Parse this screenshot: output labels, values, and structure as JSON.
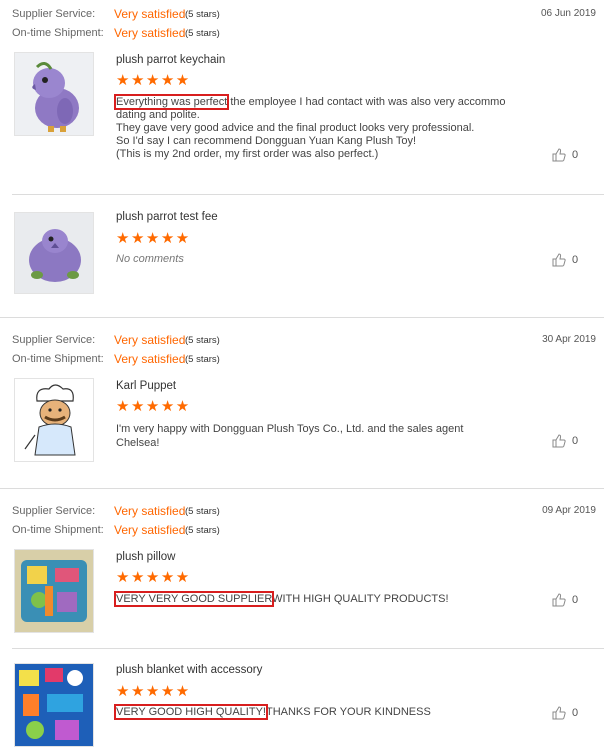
{
  "colors": {
    "accent": "#ff6600",
    "highlight": "#d81e1e",
    "divider": "#dcdcdc"
  },
  "groups": [
    {
      "supplier_label": "Supplier Service:",
      "supplier_value": "Very satisfied",
      "supplier_stars": "(5 stars)",
      "shipment_label": "On-time Shipment:",
      "shipment_value": "Very satisfied",
      "shipment_stars": "(5 stars)",
      "date": "06 Jun 2019",
      "reviews": [
        {
          "product": "plush parrot keychain",
          "rating": 5,
          "highlight": "Everything was perfect",
          "text_lines": [
            " the employee I had contact with was also very accommo",
            "dating and polite.",
            "They gave very good advice and the final product looks very professional.",
            "So I'd say I can recommend Dongguan Yuan Kang Plush Toy!",
            " (This is my 2nd order, my first order was also perfect.)"
          ],
          "likes": "0"
        },
        {
          "product": "plush parrot test fee",
          "rating": 5,
          "no_comments": "No comments",
          "likes": "0"
        }
      ]
    },
    {
      "supplier_label": "Supplier Service:",
      "supplier_value": "Very satisfied",
      "supplier_stars": "(5 stars)",
      "shipment_label": "On-time Shipment:",
      "shipment_value": "Very satisfied",
      "shipment_stars": "(5 stars)",
      "date": "30 Apr 2019",
      "reviews": [
        {
          "product": "Karl Puppet",
          "rating": 5,
          "text_pre": "I'm very happy with Dongguan",
          "text_post": "Plush Toys Co., Ltd. and the sales agent",
          "text_line2": "Chelsea!",
          "likes": "0"
        }
      ]
    },
    {
      "supplier_label": "Supplier Service:",
      "supplier_value": "Very satisfied",
      "supplier_stars": "(5 stars)",
      "shipment_label": "On-time Shipment:",
      "shipment_value": "Very satisfied",
      "shipment_stars": "(5 stars)",
      "date": "09 Apr 2019",
      "reviews": [
        {
          "product": "plush pillow",
          "rating": 5,
          "highlight": "VERY VERY GOOD SUPPLIER",
          "text_rest": "WITH HIGH QUALITY PRODUCTS!",
          "likes": "0"
        },
        {
          "product": "plush blanket with accessory",
          "rating": 5,
          "highlight": "VERY GOOD HIGH QUALITY!",
          "text_rest": "THANKS FOR YOUR KINDNESS",
          "likes": "0"
        }
      ]
    }
  ],
  "star_glyphs": "★★★★★"
}
